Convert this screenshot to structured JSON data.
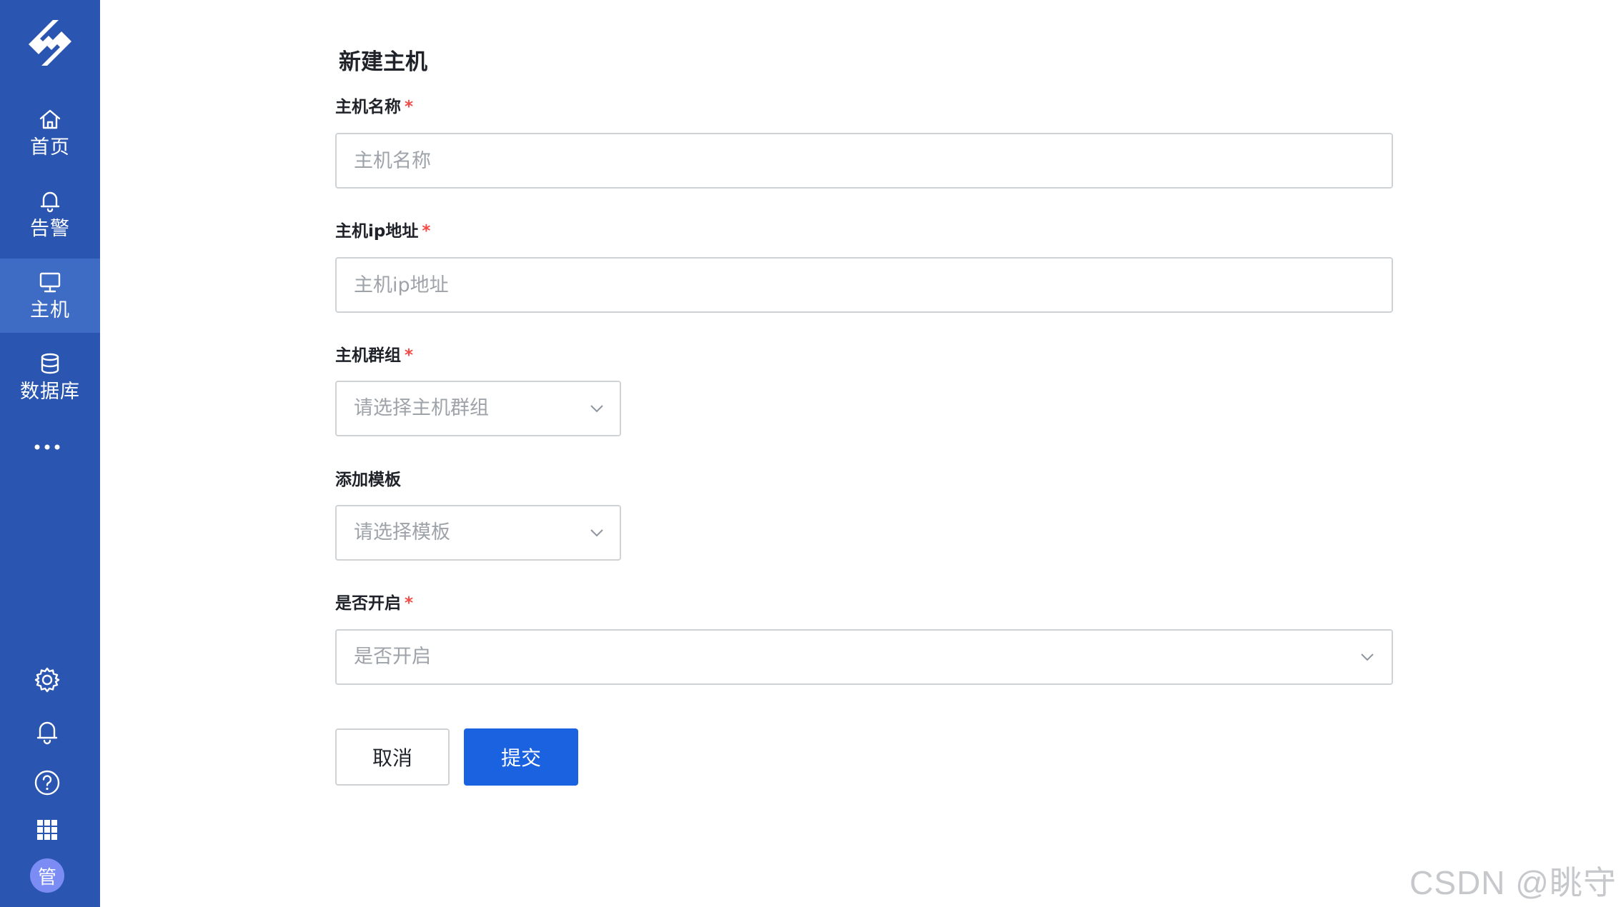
{
  "sidebar": {
    "logo_icon": "app-logo-icon",
    "nav": [
      {
        "label": "首页",
        "icon": "home-icon",
        "active": false
      },
      {
        "label": "告警",
        "icon": "bell-icon",
        "active": false
      },
      {
        "label": "主机",
        "icon": "monitor-icon",
        "active": true
      },
      {
        "label": "数据库",
        "icon": "database-icon",
        "active": false
      }
    ],
    "more_icon": "more-dots-icon",
    "bottom_icons": [
      "gear-icon",
      "bell-icon",
      "help-icon",
      "apps-grid-icon"
    ],
    "avatar_text": "管"
  },
  "form": {
    "title": "新建主机",
    "required_mark": "*",
    "host_name": {
      "label": "主机名称",
      "placeholder": "主机名称",
      "value": ""
    },
    "host_ip": {
      "label": "主机ip地址",
      "placeholder": "主机ip地址",
      "value": ""
    },
    "host_group": {
      "label": "主机群组",
      "placeholder": "请选择主机群组"
    },
    "template": {
      "label": "添加模板",
      "placeholder": "请选择模板"
    },
    "enabled": {
      "label": "是否开启",
      "placeholder": "是否开启"
    },
    "cancel_label": "取消",
    "submit_label": "提交"
  },
  "colors": {
    "sidebar_bg": "#2a55b0",
    "sidebar_active": "#3e6bc4",
    "primary": "#1a62e0",
    "required": "#f54a45"
  },
  "watermark": "CSDN @眺守"
}
